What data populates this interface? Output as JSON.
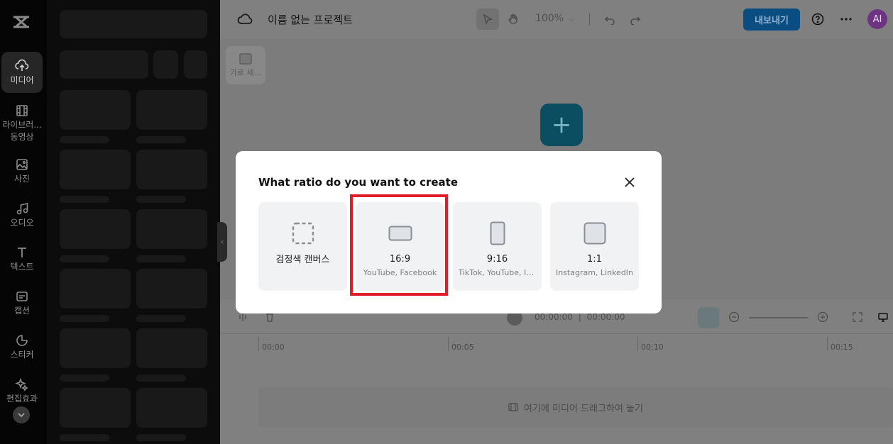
{
  "rail": {
    "items": [
      {
        "label": "미디어",
        "icon": "upload-cloud-icon"
      },
      {
        "label": "라이브러...",
        "label2": "동영상",
        "icon": "film-icon"
      },
      {
        "label": "사진",
        "icon": "image-icon"
      },
      {
        "label": "오디오",
        "icon": "music-icon"
      },
      {
        "label": "텍스트",
        "icon": "text-icon"
      },
      {
        "label": "캡션",
        "icon": "caption-icon"
      },
      {
        "label": "스티커",
        "icon": "sticker-icon"
      },
      {
        "label": "편집효과",
        "icon": "effects-icon"
      }
    ]
  },
  "header": {
    "project_title": "이름 없는 프로젝트",
    "zoom": "100%",
    "export_label": "내보내기",
    "avatar_initials": "AI"
  },
  "canvas": {
    "landscape_chip_label": "가로 세..."
  },
  "timeline": {
    "timecode_current": "00:00:00",
    "timecode_separator": "|",
    "timecode_total": "00:00:00",
    "ruler": [
      "00:00",
      "00:05",
      "00:10",
      "00:15"
    ],
    "drop_hint": "여기에 미디어 드래그하여 놓기"
  },
  "modal": {
    "title": "What ratio do you want to create",
    "options": [
      {
        "label": "검정색 캔버스",
        "sub": "",
        "icon": "dashed-square-icon"
      },
      {
        "label": "16:9",
        "sub": "YouTube, Facebook",
        "icon": "landscape-rect-icon"
      },
      {
        "label": "9:16",
        "sub": "TikTok, YouTube, Instagram",
        "icon": "portrait-rect-icon"
      },
      {
        "label": "1:1",
        "sub": "Instagram, LinkedIn",
        "icon": "square-icon"
      }
    ],
    "selected_option": "16:9"
  },
  "colors": {
    "accent_export": "#0a4d80",
    "highlight_border": "#e11d2a",
    "avatar_bg": "#6d3484"
  }
}
